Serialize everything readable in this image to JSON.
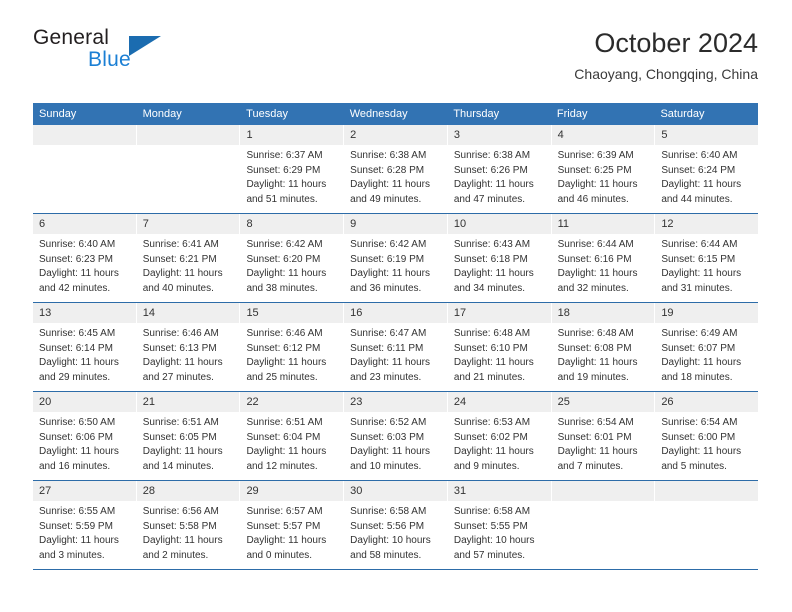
{
  "logo": {
    "word_one": "General",
    "word_two": "Blue",
    "triangle_icon": "triangle-icon"
  },
  "header": {
    "title": "October 2024",
    "subtitle": "Chaoyang, Chongqing, China"
  },
  "colors": {
    "header_blue": "#3273b3",
    "rule_blue": "#2d6ca8",
    "day_band_grey": "#efefef",
    "logo_blue": "#1b7fd4",
    "text": "#333333"
  },
  "weekdays": [
    "Sunday",
    "Monday",
    "Tuesday",
    "Wednesday",
    "Thursday",
    "Friday",
    "Saturday"
  ],
  "weeks": [
    [
      {
        "day": "",
        "empty": true
      },
      {
        "day": "",
        "empty": true
      },
      {
        "day": "1",
        "sunrise": "Sunrise: 6:37 AM",
        "sunset": "Sunset: 6:29 PM",
        "daylight": "Daylight: 11 hours and 51 minutes."
      },
      {
        "day": "2",
        "sunrise": "Sunrise: 6:38 AM",
        "sunset": "Sunset: 6:28 PM",
        "daylight": "Daylight: 11 hours and 49 minutes."
      },
      {
        "day": "3",
        "sunrise": "Sunrise: 6:38 AM",
        "sunset": "Sunset: 6:26 PM",
        "daylight": "Daylight: 11 hours and 47 minutes."
      },
      {
        "day": "4",
        "sunrise": "Sunrise: 6:39 AM",
        "sunset": "Sunset: 6:25 PM",
        "daylight": "Daylight: 11 hours and 46 minutes."
      },
      {
        "day": "5",
        "sunrise": "Sunrise: 6:40 AM",
        "sunset": "Sunset: 6:24 PM",
        "daylight": "Daylight: 11 hours and 44 minutes."
      }
    ],
    [
      {
        "day": "6",
        "sunrise": "Sunrise: 6:40 AM",
        "sunset": "Sunset: 6:23 PM",
        "daylight": "Daylight: 11 hours and 42 minutes."
      },
      {
        "day": "7",
        "sunrise": "Sunrise: 6:41 AM",
        "sunset": "Sunset: 6:21 PM",
        "daylight": "Daylight: 11 hours and 40 minutes."
      },
      {
        "day": "8",
        "sunrise": "Sunrise: 6:42 AM",
        "sunset": "Sunset: 6:20 PM",
        "daylight": "Daylight: 11 hours and 38 minutes."
      },
      {
        "day": "9",
        "sunrise": "Sunrise: 6:42 AM",
        "sunset": "Sunset: 6:19 PM",
        "daylight": "Daylight: 11 hours and 36 minutes."
      },
      {
        "day": "10",
        "sunrise": "Sunrise: 6:43 AM",
        "sunset": "Sunset: 6:18 PM",
        "daylight": "Daylight: 11 hours and 34 minutes."
      },
      {
        "day": "11",
        "sunrise": "Sunrise: 6:44 AM",
        "sunset": "Sunset: 6:16 PM",
        "daylight": "Daylight: 11 hours and 32 minutes."
      },
      {
        "day": "12",
        "sunrise": "Sunrise: 6:44 AM",
        "sunset": "Sunset: 6:15 PM",
        "daylight": "Daylight: 11 hours and 31 minutes."
      }
    ],
    [
      {
        "day": "13",
        "sunrise": "Sunrise: 6:45 AM",
        "sunset": "Sunset: 6:14 PM",
        "daylight": "Daylight: 11 hours and 29 minutes."
      },
      {
        "day": "14",
        "sunrise": "Sunrise: 6:46 AM",
        "sunset": "Sunset: 6:13 PM",
        "daylight": "Daylight: 11 hours and 27 minutes."
      },
      {
        "day": "15",
        "sunrise": "Sunrise: 6:46 AM",
        "sunset": "Sunset: 6:12 PM",
        "daylight": "Daylight: 11 hours and 25 minutes."
      },
      {
        "day": "16",
        "sunrise": "Sunrise: 6:47 AM",
        "sunset": "Sunset: 6:11 PM",
        "daylight": "Daylight: 11 hours and 23 minutes."
      },
      {
        "day": "17",
        "sunrise": "Sunrise: 6:48 AM",
        "sunset": "Sunset: 6:10 PM",
        "daylight": "Daylight: 11 hours and 21 minutes."
      },
      {
        "day": "18",
        "sunrise": "Sunrise: 6:48 AM",
        "sunset": "Sunset: 6:08 PM",
        "daylight": "Daylight: 11 hours and 19 minutes."
      },
      {
        "day": "19",
        "sunrise": "Sunrise: 6:49 AM",
        "sunset": "Sunset: 6:07 PM",
        "daylight": "Daylight: 11 hours and 18 minutes."
      }
    ],
    [
      {
        "day": "20",
        "sunrise": "Sunrise: 6:50 AM",
        "sunset": "Sunset: 6:06 PM",
        "daylight": "Daylight: 11 hours and 16 minutes."
      },
      {
        "day": "21",
        "sunrise": "Sunrise: 6:51 AM",
        "sunset": "Sunset: 6:05 PM",
        "daylight": "Daylight: 11 hours and 14 minutes."
      },
      {
        "day": "22",
        "sunrise": "Sunrise: 6:51 AM",
        "sunset": "Sunset: 6:04 PM",
        "daylight": "Daylight: 11 hours and 12 minutes."
      },
      {
        "day": "23",
        "sunrise": "Sunrise: 6:52 AM",
        "sunset": "Sunset: 6:03 PM",
        "daylight": "Daylight: 11 hours and 10 minutes."
      },
      {
        "day": "24",
        "sunrise": "Sunrise: 6:53 AM",
        "sunset": "Sunset: 6:02 PM",
        "daylight": "Daylight: 11 hours and 9 minutes."
      },
      {
        "day": "25",
        "sunrise": "Sunrise: 6:54 AM",
        "sunset": "Sunset: 6:01 PM",
        "daylight": "Daylight: 11 hours and 7 minutes."
      },
      {
        "day": "26",
        "sunrise": "Sunrise: 6:54 AM",
        "sunset": "Sunset: 6:00 PM",
        "daylight": "Daylight: 11 hours and 5 minutes."
      }
    ],
    [
      {
        "day": "27",
        "sunrise": "Sunrise: 6:55 AM",
        "sunset": "Sunset: 5:59 PM",
        "daylight": "Daylight: 11 hours and 3 minutes."
      },
      {
        "day": "28",
        "sunrise": "Sunrise: 6:56 AM",
        "sunset": "Sunset: 5:58 PM",
        "daylight": "Daylight: 11 hours and 2 minutes."
      },
      {
        "day": "29",
        "sunrise": "Sunrise: 6:57 AM",
        "sunset": "Sunset: 5:57 PM",
        "daylight": "Daylight: 11 hours and 0 minutes."
      },
      {
        "day": "30",
        "sunrise": "Sunrise: 6:58 AM",
        "sunset": "Sunset: 5:56 PM",
        "daylight": "Daylight: 10 hours and 58 minutes."
      },
      {
        "day": "31",
        "sunrise": "Sunrise: 6:58 AM",
        "sunset": "Sunset: 5:55 PM",
        "daylight": "Daylight: 10 hours and 57 minutes."
      },
      {
        "day": "",
        "empty": true
      },
      {
        "day": "",
        "empty": true
      }
    ]
  ]
}
